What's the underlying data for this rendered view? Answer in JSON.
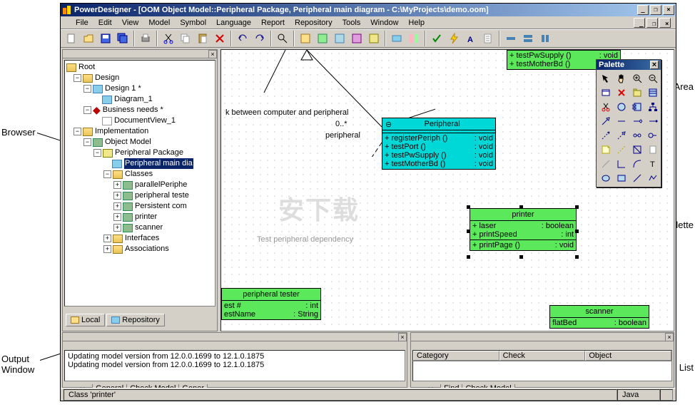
{
  "title": "PowerDesigner - [OOM Object Model::Peripheral Package, Peripheral main diagram - C:\\MyProjects\\demo.oom]",
  "menu": {
    "items": [
      "File",
      "Edit",
      "View",
      "Model",
      "Symbol",
      "Language",
      "Report",
      "Repository",
      "Tools",
      "Window",
      "Help"
    ]
  },
  "tree": {
    "root": "Root",
    "n1": "Design",
    "n2": "Design 1 *",
    "n3": "Diagram_1",
    "n4": "Business needs *",
    "n5": "DocumentView_1",
    "n6": "Implementation",
    "n7": "Object Model",
    "n8": "Peripheral Package",
    "n9": "Peripheral main dia",
    "n10": "Classes",
    "n11": "parallelPeriphe",
    "n12": "peripheral teste",
    "n13": "Persistent com",
    "n14": "printer",
    "n15": "scanner",
    "n16": "Interfaces",
    "n17": "Associations"
  },
  "browser_tabs": {
    "local": "Local",
    "repo": "Repository"
  },
  "workarea": {
    "link_text": "k between computer and peripheral",
    "card": "0..*",
    "periph_lbl": "peripheral",
    "dep_text": "Test peripheral dependency",
    "peripheral": {
      "name": "Peripheral",
      "ops": [
        {
          "sig": "+ registerPeriph ()",
          "ret": ": void"
        },
        {
          "sig": "+ testPort ()",
          "ret": ": void"
        },
        {
          "sig": "+ testPwSupply ()",
          "ret": ": void"
        },
        {
          "sig": "+ testMotherBd ()",
          "ret": ": void"
        }
      ]
    },
    "topgreen": {
      "ops": [
        {
          "sig": "+ testPwSupply ()",
          "ret": ": void"
        },
        {
          "sig": "+ testMotherBd ()",
          "ret": ": void"
        }
      ]
    },
    "printer": {
      "name": "printer",
      "attrs": [
        {
          "n": "+ laser",
          "t": ": boolean"
        },
        {
          "n": "+ printSpeed",
          "t": ": int"
        }
      ],
      "ops": [
        {
          "sig": "+ printPage ()",
          "ret": ": void"
        }
      ]
    },
    "tester": {
      "name": "peripheral tester",
      "attrs": [
        {
          "n": "est #",
          "t": ": int"
        },
        {
          "n": "estName",
          "t": ": String"
        }
      ]
    },
    "scanner": {
      "name": "scanner",
      "attr": "flatBed",
      "attr_t": ": boolean"
    }
  },
  "palette": {
    "title": "Palette"
  },
  "output": {
    "line1": "Updating model version from 12.0.0.1699 to 12.1.0.1875",
    "line2": "Updating model version from 12.0.0.1699 to 12.1.0.1875",
    "tabs": [
      "General",
      "Check Model",
      "Gener"
    ]
  },
  "result": {
    "cols": [
      "Category",
      "Check",
      "Object"
    ],
    "tabs": [
      "Find",
      "Check Model"
    ]
  },
  "status": {
    "left": "Class 'printer'",
    "right": "Java"
  },
  "annot": {
    "browser": "Browser",
    "work": "Work Area",
    "palette": "Tool Palette",
    "output": "Output\nWindow",
    "result": "Result List"
  }
}
